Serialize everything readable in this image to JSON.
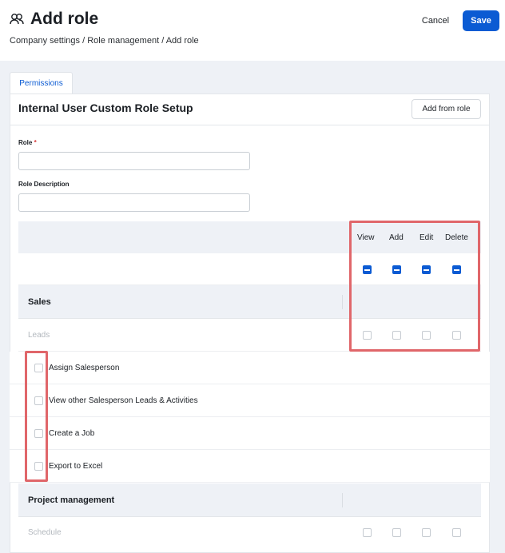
{
  "header": {
    "title": "Add role",
    "breadcrumb": [
      "Company settings",
      "Role management",
      "Add role"
    ],
    "cancel_label": "Cancel",
    "save_label": "Save"
  },
  "tabs": [
    {
      "label": "Permissions",
      "active": true
    }
  ],
  "setup": {
    "title": "Internal User Custom Role Setup",
    "add_from_role_label": "Add from role"
  },
  "form": {
    "role": {
      "label": "Role",
      "required_marker": "*",
      "value": ""
    },
    "description": {
      "label": "Role Description",
      "value": ""
    }
  },
  "permission_columns": [
    "View",
    "Add",
    "Edit",
    "Delete"
  ],
  "sections": [
    {
      "name": "Sales",
      "subsection": "Leads",
      "permissions": [
        "Assign Salesperson",
        "View other Salesperson Leads & Activities",
        "Create a Job",
        "Export to Excel"
      ]
    },
    {
      "name": "Project management",
      "subsection": "Schedule"
    }
  ],
  "colors": {
    "accent": "#0b5bd3",
    "highlight": "#e0666a",
    "band": "#eef1f6"
  },
  "icons": {
    "title_icon": "users-icon"
  }
}
